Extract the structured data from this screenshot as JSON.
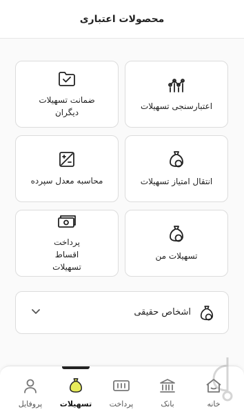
{
  "header": {
    "title": "محصولات اعتباری"
  },
  "cards": [
    {
      "label": "اعتبارسنجی تسهیلات",
      "icon": "chart-nodes-icon"
    },
    {
      "label": "ضمانت تسهیلات دیگران",
      "icon": "folder-check-icon"
    },
    {
      "label": "انتقال امتیاز تسهیلات",
      "icon": "money-bag-icon"
    },
    {
      "label": "محاسبه معدل سپرده",
      "icon": "calculator-icon"
    },
    {
      "label": "تسهیلات من",
      "icon": "money-bag-icon"
    },
    {
      "label": "پرداخت اقساط تسهیلات",
      "icon": "cash-icon"
    }
  ],
  "expander": {
    "label": "اشخاص حقیقی",
    "icon": "money-bag-icon",
    "chevron": "chevron-down-icon"
  },
  "nav": [
    {
      "label": "خانه",
      "icon": "home-icon"
    },
    {
      "label": "بانک",
      "icon": "bank-icon"
    },
    {
      "label": "پرداخت",
      "icon": "payment-icon"
    },
    {
      "label": "تسهیلات",
      "icon": "money-bag-icon",
      "active": true
    },
    {
      "label": "پروفایل",
      "icon": "user-icon"
    }
  ],
  "colors": {
    "accent": "#e8ec5a",
    "text": "#222222",
    "border": "#dcdcdc"
  }
}
